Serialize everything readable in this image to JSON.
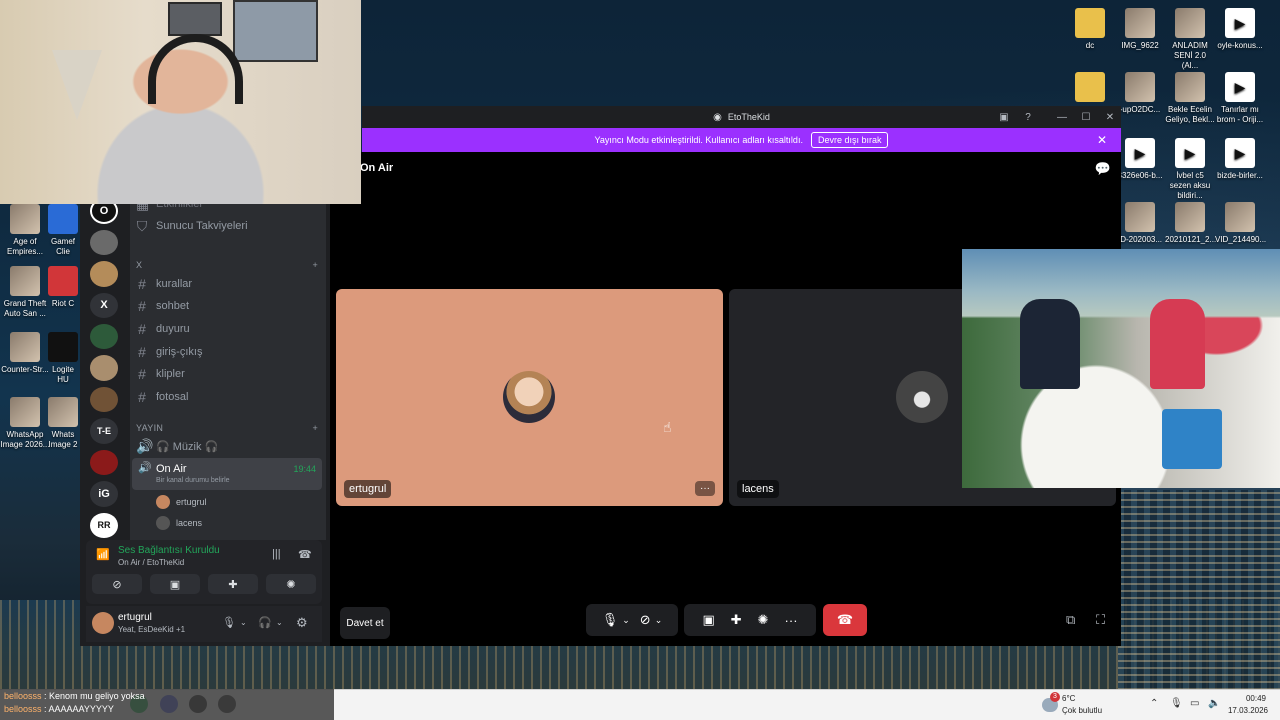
{
  "window": {
    "title": "EtoTheKid",
    "controls": [
      "inbox-icon",
      "help-icon",
      "minimize",
      "maximize",
      "close"
    ]
  },
  "banner": {
    "text": "Yayıncı Modu etkinleştirildi. Kullanıcı adları kısaltıldı.",
    "button": "Devre dışı bırak",
    "close": "✕"
  },
  "stage": {
    "channel_title": "On Air",
    "tiles": [
      {
        "name": "ertugrul",
        "bg": "#dc9a7c"
      },
      {
        "name": "lacens",
        "bg": "#232428"
      }
    ],
    "invite_button": "Davet et",
    "more": "···"
  },
  "sidebar": {
    "truncated_top": "Etkinlikler",
    "boost": "Sunucu Takviyeleri",
    "category_x": "X",
    "text_channels": [
      "kurallar",
      "sohbet",
      "duyuru",
      "giriş-çıkış",
      "klipler",
      "fotosal"
    ],
    "category_yayin": "YAYIN",
    "voice_channels": [
      {
        "name": "🎧 Müzik 🎧"
      },
      {
        "name": "On Air",
        "time": "19:44",
        "status": "Bir kanal durumu belirle"
      }
    ],
    "voice_users": [
      "ertugrul",
      "lacens"
    ]
  },
  "guilds": [
    "O",
    "",
    "",
    "X",
    "",
    "",
    "",
    "T-E",
    "",
    "iG",
    "RR"
  ],
  "voice_panel": {
    "status": "Ses Bağlantısı Kuruldu",
    "channel": "On Air / EtoTheKid"
  },
  "user_panel": {
    "name": "ertugrul",
    "activity": "Yeat, EsDeeKid +1"
  },
  "desktop_icons": [
    {
      "label": "dc",
      "type": "folder"
    },
    {
      "label": "IMG_9622",
      "type": "photo"
    },
    {
      "label": "ANLADIM SENİ 2.0 (Al...",
      "type": "photo"
    },
    {
      "label": "oyle-konus...",
      "type": "video"
    },
    {
      "label": "",
      "type": "folder"
    },
    {
      "label": "-upO2DC...",
      "type": "photo"
    },
    {
      "label": "Bekle Ecelin Geliyo, Bekl...",
      "type": "photo"
    },
    {
      "label": "Tanırlar mı brom - Oriji...",
      "type": "video"
    },
    {
      "label": "3326e06-b...",
      "type": "video"
    },
    {
      "label": "İvbel c5 sezen aksu bildiri...",
      "type": "video"
    },
    {
      "label": "bizde-birler...",
      "type": "video"
    },
    {
      "label": "ID-202003...",
      "type": "photo"
    },
    {
      "label": "20210121_2...",
      "type": "photo"
    },
    {
      "label": "VID_214490...",
      "type": "photo"
    },
    {
      "label": "Age of Empires...",
      "type": "photo"
    },
    {
      "label": "Gamef Clie",
      "type": "photo"
    },
    {
      "label": "Grand Theft Auto San ...",
      "type": "photo"
    },
    {
      "label": "Riot C",
      "type": "photo"
    },
    {
      "label": "Counter-Str...",
      "type": "photo"
    },
    {
      "label": "Logite HU",
      "type": "photo"
    },
    {
      "label": "WhatsApp Image 2026...",
      "type": "photo"
    },
    {
      "label": "Whats Image 2",
      "type": "photo"
    }
  ],
  "chat_overlay": [
    {
      "user": "belloosss",
      "msg": "Kenom mu geliyo yoksa"
    },
    {
      "user": "belloosss",
      "msg": "AAAAAAYYYYY"
    }
  ],
  "taskbar": {
    "weather_temp": "6°C",
    "weather_text": "Çok bulutlu",
    "weather_badge": "3",
    "time": "00:49",
    "date": "17.03.2026"
  }
}
